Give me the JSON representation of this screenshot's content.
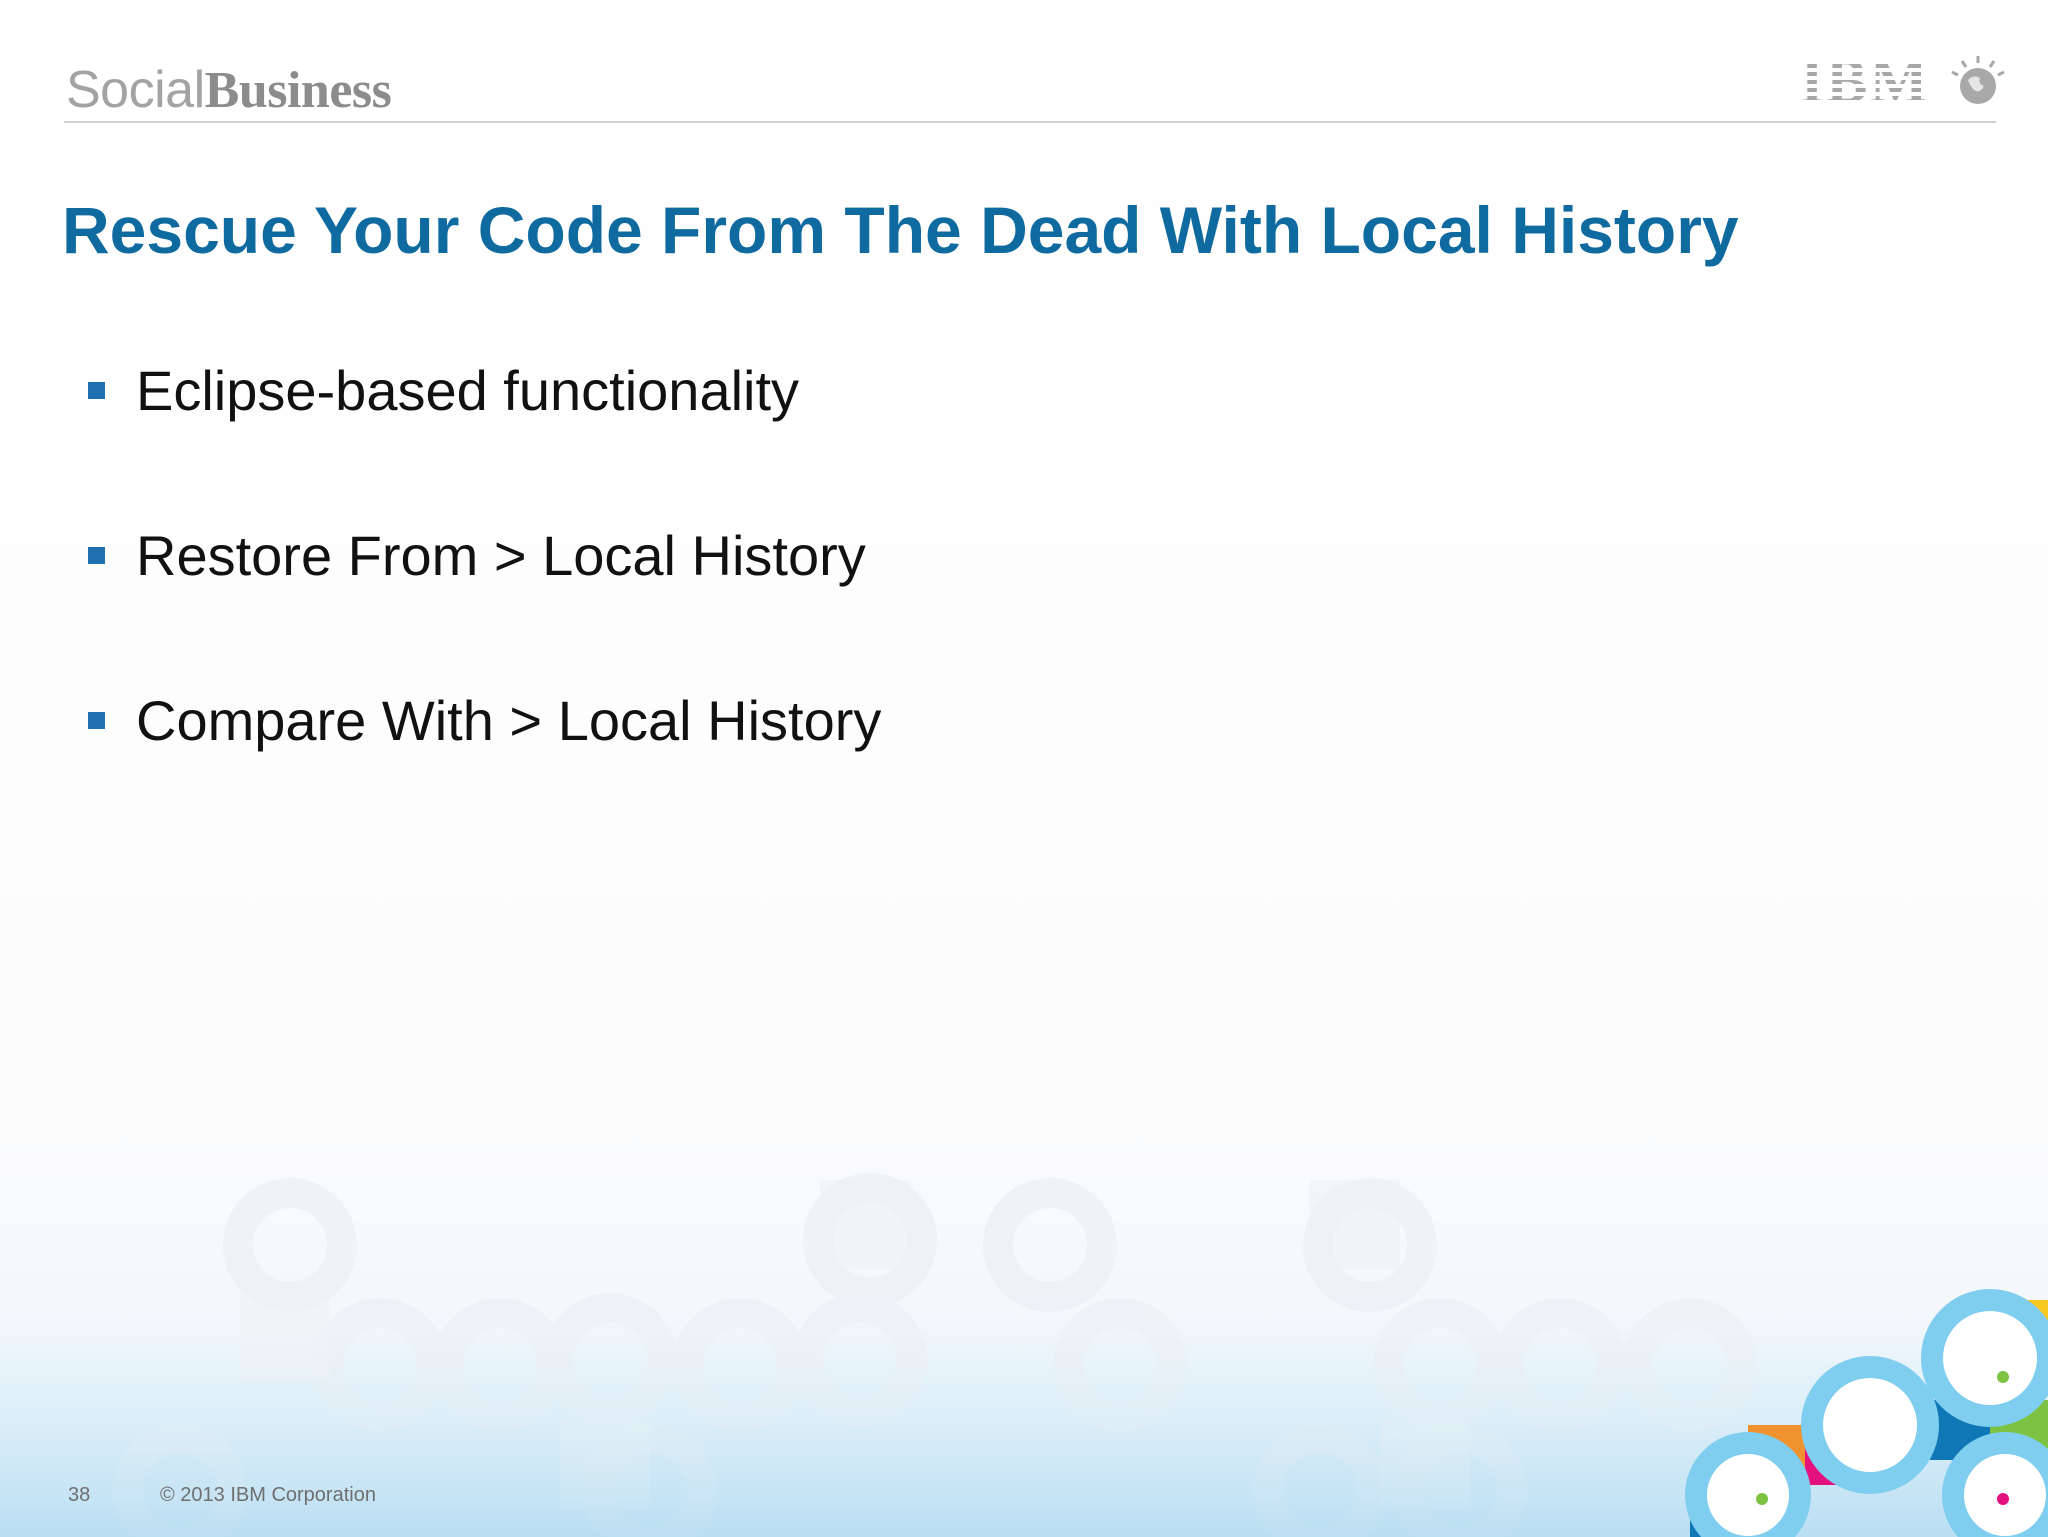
{
  "header": {
    "brand_light": "Social",
    "brand_bold": "Business",
    "logo_text": "IBM"
  },
  "slide": {
    "title": "Rescue Your Code From The Dead With Local History",
    "bullets": [
      {
        "text": "Eclipse-based functionality"
      },
      {
        "text": "Restore From > Local History"
      },
      {
        "text": "Compare With > Local History"
      }
    ]
  },
  "footer": {
    "page_number": "38",
    "copyright": "© 2013 IBM Corporation"
  },
  "colors": {
    "title": "#0f6aa0",
    "bullet": "#1f70b0",
    "footer_band": "#c3e3f4",
    "accent_orange": "#f0922e",
    "accent_magenta": "#e5117f",
    "accent_green": "#7dc242",
    "accent_blue": "#0f77b6",
    "accent_light_blue": "#7fcdef",
    "accent_yellow": "#f7c81e"
  },
  "icons": {
    "logo": "ibm-logo-icon",
    "globe": "smarter-planet-globe-icon"
  }
}
